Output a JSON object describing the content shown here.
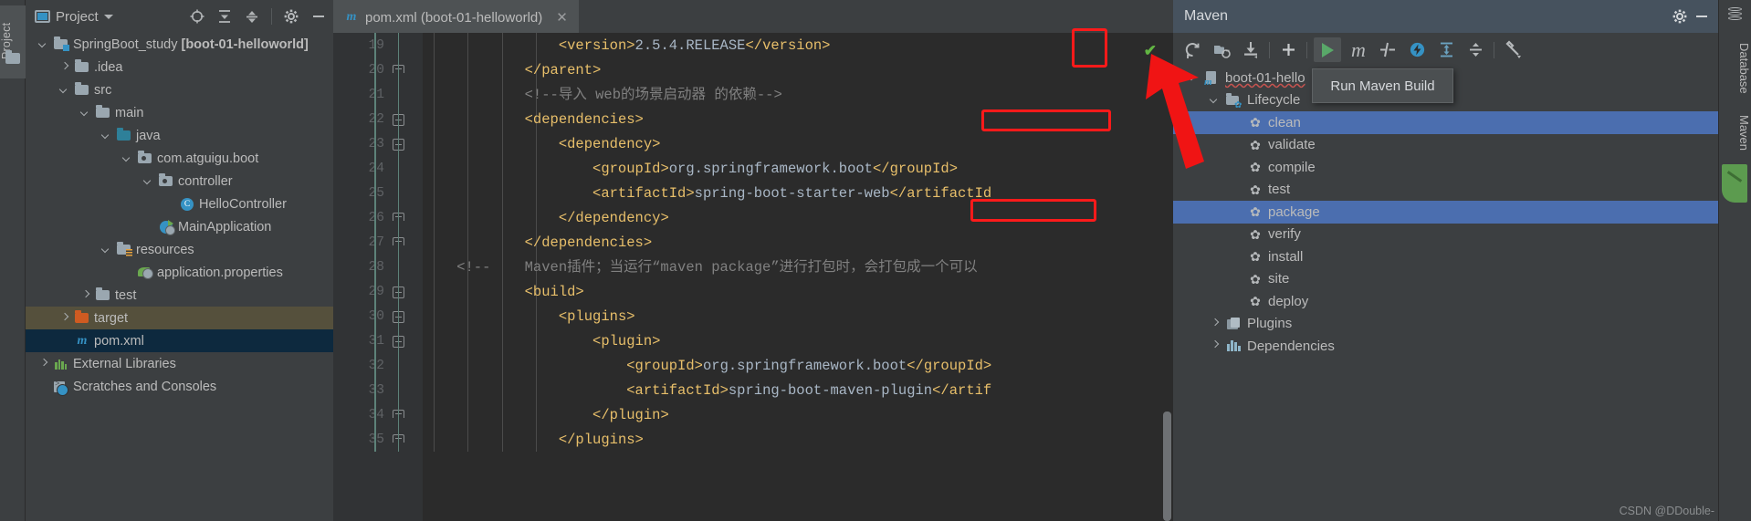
{
  "left_strip": {
    "tab_label": "Project",
    "folder_icon": "folder-icon"
  },
  "project_panel": {
    "header": {
      "view_icon": "project-view-icon",
      "title": "Project",
      "dropdown_icon": "chevron-down-icon",
      "locate_icon": "crosshair-locate-icon",
      "expand_all_icon": "expand-all-icon",
      "collapse_all_icon": "collapse-all-icon",
      "settings_icon": "gear-icon",
      "hide_icon": "minimize-icon"
    },
    "tree": [
      {
        "label": "SpringBoot_study ",
        "bold_suffix": "[boot-01-helloworld]",
        "icon": "module-folder-icon",
        "arrow": "down",
        "indent": 0,
        "state": "normal"
      },
      {
        "label": ".idea",
        "icon": "folder-icon",
        "arrow": "right",
        "indent": 1,
        "state": "normal"
      },
      {
        "label": "src",
        "icon": "folder-icon",
        "arrow": "down",
        "indent": 1,
        "state": "normal"
      },
      {
        "label": "main",
        "icon": "folder-icon",
        "arrow": "down",
        "indent": 2,
        "state": "normal"
      },
      {
        "label": "java",
        "icon": "source-folder-icon",
        "arrow": "down",
        "indent": 3,
        "state": "normal"
      },
      {
        "label": "com.atguigu.boot",
        "icon": "package-icon",
        "arrow": "down",
        "indent": 4,
        "state": "normal"
      },
      {
        "label": "controller",
        "icon": "package-icon",
        "arrow": "down",
        "indent": 5,
        "state": "normal"
      },
      {
        "label": "HelloController",
        "icon": "java-class-icon",
        "arrow": "none",
        "indent": 6,
        "state": "normal"
      },
      {
        "label": "MainApplication",
        "icon": "spring-boot-application-icon",
        "arrow": "none",
        "indent": 5,
        "state": "normal"
      },
      {
        "label": "resources",
        "icon": "resources-folder-icon",
        "arrow": "down",
        "indent": 3,
        "state": "normal"
      },
      {
        "label": "application.properties",
        "icon": "spring-properties-icon",
        "arrow": "none",
        "indent": 4,
        "state": "normal"
      },
      {
        "label": "test",
        "icon": "folder-icon",
        "arrow": "right",
        "indent": 2,
        "state": "normal"
      },
      {
        "label": "target",
        "icon": "excluded-folder-icon",
        "arrow": "right",
        "indent": 1,
        "state": "olive"
      },
      {
        "label": "pom.xml",
        "icon": "maven-file-icon",
        "arrow": "none",
        "indent": 1,
        "state": "selected"
      },
      {
        "label": "External Libraries",
        "icon": "external-libraries-icon",
        "arrow": "right",
        "indent": 0,
        "state": "normal"
      },
      {
        "label": "Scratches and Consoles",
        "icon": "scratches-icon",
        "arrow": "none",
        "indent": 0,
        "state": "normal"
      }
    ]
  },
  "editor": {
    "tab": {
      "icon": "maven-file-icon",
      "label": "pom.xml (boot-01-helloworld)",
      "close_icon": "close-icon"
    },
    "inspection_status_icon": "ok-check-icon",
    "first_visible_line": 19,
    "lines": [
      {
        "num": 19,
        "fold": "line",
        "segments": [
          {
            "t": "                ",
            "c": "txt"
          },
          {
            "t": "<version>",
            "c": "tg"
          },
          {
            "t": "2.5.4.RELEASE",
            "c": "txt"
          },
          {
            "t": "</version>",
            "c": "tg"
          }
        ]
      },
      {
        "num": 20,
        "fold": "end",
        "segments": [
          {
            "t": "            ",
            "c": "txt"
          },
          {
            "t": "</parent>",
            "c": "tg"
          }
        ]
      },
      {
        "num": 21,
        "fold": "line",
        "segments": [
          {
            "t": "            ",
            "c": "txt"
          },
          {
            "t": "<!--导入 web的场景启动器 的依赖-->",
            "c": "cm"
          }
        ]
      },
      {
        "num": 22,
        "fold": "minus",
        "segments": [
          {
            "t": "            ",
            "c": "txt"
          },
          {
            "t": "<dependencies>",
            "c": "tg"
          }
        ]
      },
      {
        "num": 23,
        "fold": "minus",
        "segments": [
          {
            "t": "                ",
            "c": "txt"
          },
          {
            "t": "<dependency>",
            "c": "tg"
          }
        ]
      },
      {
        "num": 24,
        "fold": "line",
        "segments": [
          {
            "t": "                    ",
            "c": "txt"
          },
          {
            "t": "<groupId>",
            "c": "tg"
          },
          {
            "t": "org.springframework.boot",
            "c": "txt"
          },
          {
            "t": "</groupId>",
            "c": "tg"
          }
        ]
      },
      {
        "num": 25,
        "fold": "line",
        "segments": [
          {
            "t": "                    ",
            "c": "txt"
          },
          {
            "t": "<artifactId>",
            "c": "tg"
          },
          {
            "t": "spring-boot-starter-web",
            "c": "txt"
          },
          {
            "t": "</artifactId",
            "c": "tg"
          }
        ]
      },
      {
        "num": 26,
        "fold": "end",
        "segments": [
          {
            "t": "                ",
            "c": "txt"
          },
          {
            "t": "</dependency>",
            "c": "tg"
          }
        ]
      },
      {
        "num": 27,
        "fold": "end",
        "segments": [
          {
            "t": "            ",
            "c": "txt"
          },
          {
            "t": "</dependencies>",
            "c": "tg"
          }
        ]
      },
      {
        "num": 28,
        "fold": "none",
        "segments": [
          {
            "t": "    <!--    Maven插件；当运行“maven package”进行打包时，会打包成一个可以",
            "c": "cm"
          }
        ]
      },
      {
        "num": 29,
        "fold": "minus",
        "segments": [
          {
            "t": "            ",
            "c": "txt"
          },
          {
            "t": "<build>",
            "c": "tg"
          }
        ]
      },
      {
        "num": 30,
        "fold": "minus",
        "segments": [
          {
            "t": "                ",
            "c": "txt"
          },
          {
            "t": "<plugins>",
            "c": "tg"
          }
        ]
      },
      {
        "num": 31,
        "fold": "minus",
        "segments": [
          {
            "t": "                    ",
            "c": "txt"
          },
          {
            "t": "<plugin>",
            "c": "tg"
          }
        ]
      },
      {
        "num": 32,
        "fold": "line",
        "segments": [
          {
            "t": "                        ",
            "c": "txt"
          },
          {
            "t": "<groupId>",
            "c": "tg"
          },
          {
            "t": "org.springframework.boot",
            "c": "txt"
          },
          {
            "t": "</groupId>",
            "c": "tg"
          }
        ]
      },
      {
        "num": 33,
        "fold": "line",
        "segments": [
          {
            "t": "                        ",
            "c": "txt"
          },
          {
            "t": "<artifactId>",
            "c": "tg"
          },
          {
            "t": "spring-boot-maven-plugin",
            "c": "txt"
          },
          {
            "t": "</artif",
            "c": "tg"
          }
        ]
      },
      {
        "num": 34,
        "fold": "end",
        "segments": [
          {
            "t": "                    ",
            "c": "txt"
          },
          {
            "t": "</plugin>",
            "c": "tg"
          }
        ]
      },
      {
        "num": 35,
        "fold": "end",
        "segments": [
          {
            "t": "                ",
            "c": "txt"
          },
          {
            "t": "</plugins>",
            "c": "tg"
          }
        ]
      }
    ]
  },
  "maven_panel": {
    "header": {
      "title": "Maven",
      "settings_icon": "gear-icon",
      "hide_icon": "minimize-icon",
      "header_bg": "#46525e"
    },
    "toolbar": [
      {
        "name": "reimport-icon",
        "tooltip": ""
      },
      {
        "name": "add-maven-projects-icon",
        "tooltip": ""
      },
      {
        "name": "download-sources-icon",
        "tooltip": ""
      },
      {
        "name": "separator",
        "tooltip": ""
      },
      {
        "name": "add-icon",
        "tooltip": ""
      },
      {
        "name": "separator",
        "tooltip": ""
      },
      {
        "name": "run-maven-build-icon",
        "tooltip": "Run Maven Build",
        "highlighted": true,
        "accent": "#59a869"
      },
      {
        "name": "execute-maven-goal-icon",
        "tooltip": ""
      },
      {
        "name": "toggle-skip-tests-icon",
        "tooltip": ""
      },
      {
        "name": "toggle-offline-mode-icon",
        "tooltip": ""
      },
      {
        "name": "expand-all-icon",
        "tooltip": ""
      },
      {
        "name": "collapse-all-icon",
        "tooltip": ""
      },
      {
        "name": "separator",
        "tooltip": ""
      },
      {
        "name": "maven-settings-wrench-icon",
        "tooltip": ""
      }
    ],
    "tooltip_text": "Run Maven Build",
    "annotation_color": "#ff1a1a",
    "tree": [
      {
        "label": "boot-01-hello",
        "icon": "maven-module-icon",
        "arrow": "down",
        "indent": 0,
        "state": "normal",
        "squiggle": true
      },
      {
        "label": "Lifecycle",
        "icon": "lifecycle-folder-icon",
        "arrow": "down",
        "indent": 1,
        "state": "normal"
      },
      {
        "label": "clean",
        "icon": "maven-goal-gear-icon",
        "arrow": "none",
        "indent": 2,
        "state": "selected",
        "boxed": true
      },
      {
        "label": "validate",
        "icon": "maven-goal-gear-icon",
        "arrow": "none",
        "indent": 2,
        "state": "normal"
      },
      {
        "label": "compile",
        "icon": "maven-goal-gear-icon",
        "arrow": "none",
        "indent": 2,
        "state": "normal"
      },
      {
        "label": "test",
        "icon": "maven-goal-gear-icon",
        "arrow": "none",
        "indent": 2,
        "state": "normal"
      },
      {
        "label": "package",
        "icon": "maven-goal-gear-icon",
        "arrow": "none",
        "indent": 2,
        "state": "selected",
        "boxed": true
      },
      {
        "label": "verify",
        "icon": "maven-goal-gear-icon",
        "arrow": "none",
        "indent": 2,
        "state": "normal"
      },
      {
        "label": "install",
        "icon": "maven-goal-gear-icon",
        "arrow": "none",
        "indent": 2,
        "state": "normal"
      },
      {
        "label": "site",
        "icon": "maven-goal-gear-icon",
        "arrow": "none",
        "indent": 2,
        "state": "normal"
      },
      {
        "label": "deploy",
        "icon": "maven-goal-gear-icon",
        "arrow": "none",
        "indent": 2,
        "state": "normal"
      },
      {
        "label": "Plugins",
        "icon": "plugins-icon",
        "arrow": "right",
        "indent": 1,
        "state": "normal"
      },
      {
        "label": "Dependencies",
        "icon": "dependencies-icon",
        "arrow": "right",
        "indent": 1,
        "state": "normal"
      }
    ]
  },
  "right_strip": {
    "database_tab": "Database",
    "maven_tab": "Maven",
    "database_icon": "database-icon",
    "maven_icon": "maven-leaf-icon"
  },
  "watermark": "CSDN @DDouble-"
}
